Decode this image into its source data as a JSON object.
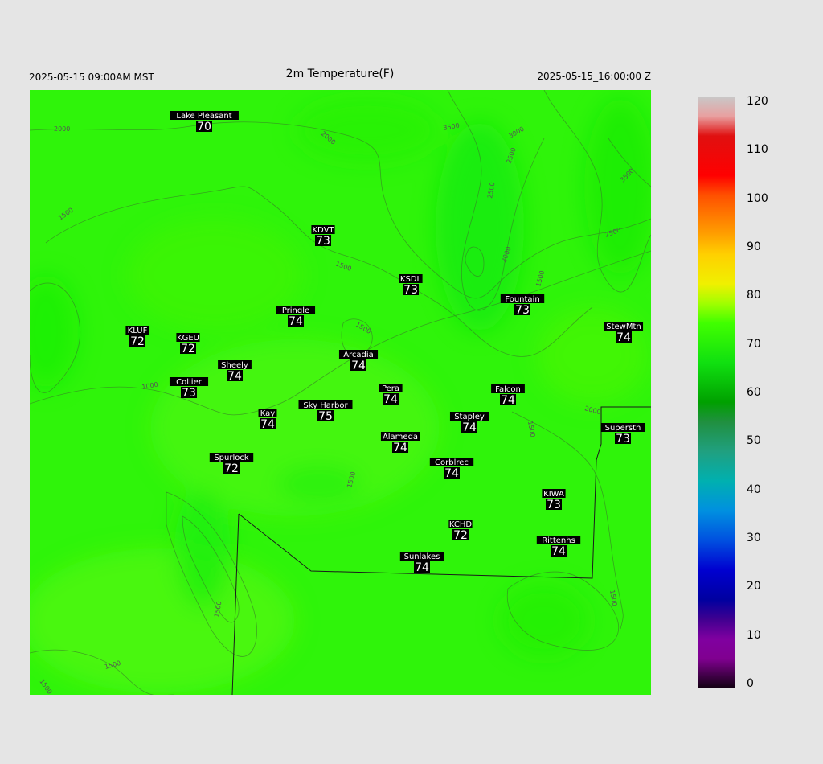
{
  "header": {
    "local_time": "2025-05-15 09:00AM MST",
    "title": "2m Temperature(F)",
    "utc_time": "2025-05-15_16:00:00 Z"
  },
  "colors": {
    "background": "#e5e5e5",
    "field_main": "#2ff40a",
    "field_warm": "#56f80c",
    "field_cool": "#0cec0a",
    "label_bg": "#000000",
    "label_text": "#ffffff"
  },
  "colorbar": {
    "min": 0,
    "max": 120,
    "ticks": [
      "120",
      "110",
      "100",
      "90",
      "80",
      "70",
      "60",
      "50",
      "40",
      "30",
      "20",
      "10",
      "0"
    ]
  },
  "contour_labels": [
    "2000",
    "1500",
    "1000",
    "2000",
    "2500",
    "3000",
    "3500",
    "2500",
    "2000",
    "1500",
    "3500",
    "2500",
    "1500",
    "2000",
    "1500",
    "1500",
    "1500",
    "1500",
    "1500",
    "1500",
    "1500"
  ],
  "stations": [
    {
      "name": "Lake Pleasant",
      "value": "70"
    },
    {
      "name": "KDVT",
      "value": "73"
    },
    {
      "name": "KSDL",
      "value": "73"
    },
    {
      "name": "Fountain",
      "value": "73"
    },
    {
      "name": "Pringle",
      "value": "74"
    },
    {
      "name": "KLUF",
      "value": "72"
    },
    {
      "name": "KGEU",
      "value": "72"
    },
    {
      "name": "StewMtn",
      "value": "74"
    },
    {
      "name": "Arcadia",
      "value": "74"
    },
    {
      "name": "Sheely",
      "value": "74"
    },
    {
      "name": "Collier",
      "value": "73"
    },
    {
      "name": "Pera",
      "value": "74"
    },
    {
      "name": "Falcon",
      "value": "74"
    },
    {
      "name": "Sky Harbor",
      "value": "75"
    },
    {
      "name": "Kay",
      "value": "74"
    },
    {
      "name": "Stapley",
      "value": "74"
    },
    {
      "name": "Superstn",
      "value": "73"
    },
    {
      "name": "Alameda",
      "value": "74"
    },
    {
      "name": "Spurlock",
      "value": "72"
    },
    {
      "name": "Corblrec",
      "value": "74"
    },
    {
      "name": "KIWA",
      "value": "73"
    },
    {
      "name": "KCHD",
      "value": "72"
    },
    {
      "name": "Rittenhs",
      "value": "74"
    },
    {
      "name": "Sunlakes",
      "value": "74"
    }
  ]
}
